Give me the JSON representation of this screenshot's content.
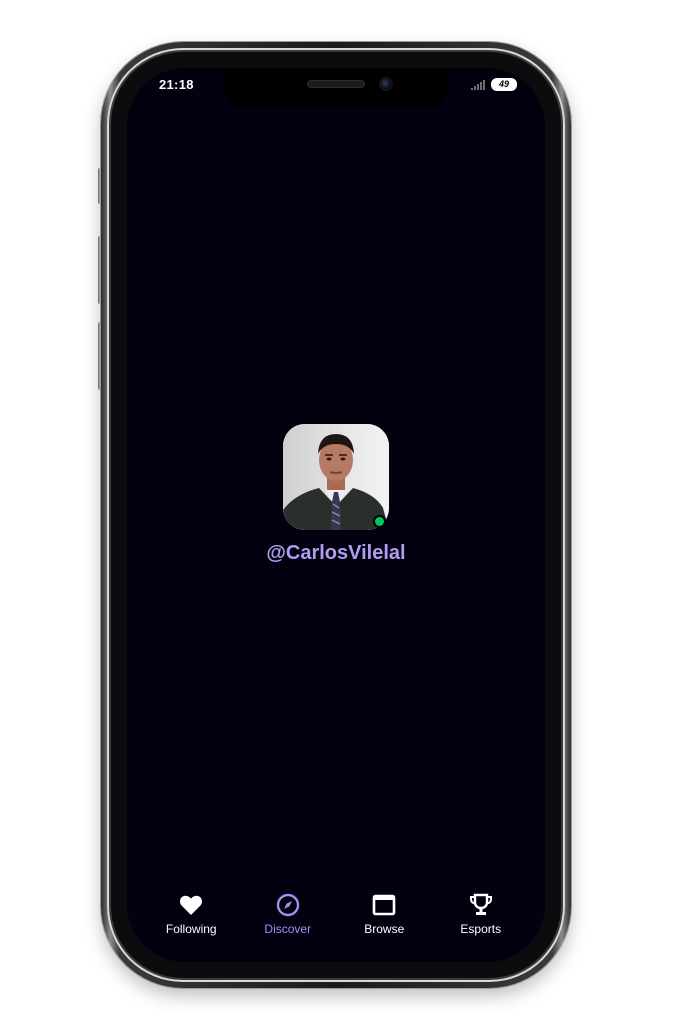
{
  "status_bar": {
    "time": "21:18",
    "battery": "49"
  },
  "profile": {
    "username": "@CarlosVilelal",
    "online": true
  },
  "tabs": [
    {
      "label": "Following",
      "icon": "heart-icon",
      "active": false
    },
    {
      "label": "Discover",
      "icon": "compass-icon",
      "active": true
    },
    {
      "label": "Browse",
      "icon": "browse-icon",
      "active": false
    },
    {
      "label": "Esports",
      "icon": "trophy-icon",
      "active": false
    }
  ],
  "colors": {
    "background": "#01010f",
    "accent": "#a98ef0",
    "online": "#00c853",
    "tab_inactive": "#ffffff"
  }
}
